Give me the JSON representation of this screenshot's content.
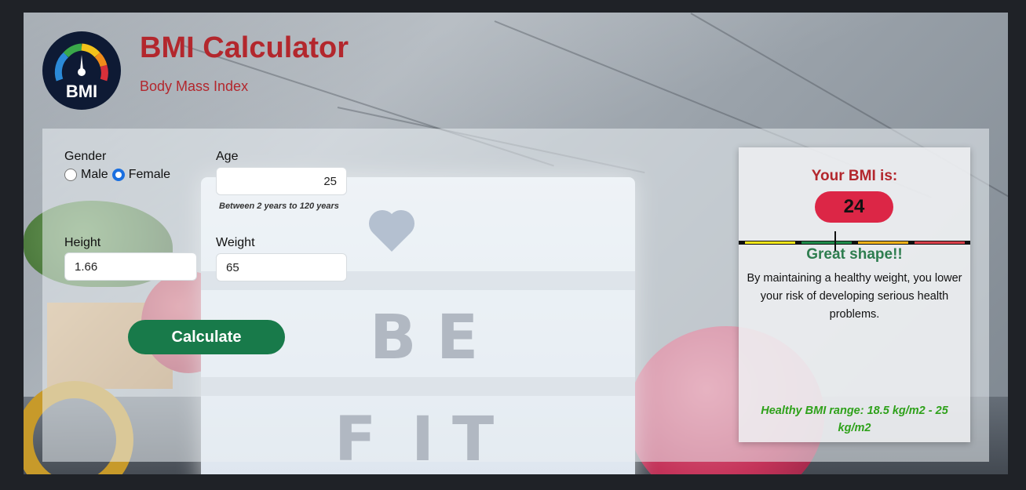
{
  "header": {
    "logo_text": "BMI",
    "title": "BMI Calculator",
    "subtitle": "Body Mass Index"
  },
  "background": {
    "lightbox_letters": [
      "B",
      "E",
      "F",
      "I",
      "T"
    ]
  },
  "form": {
    "gender_label": "Gender",
    "gender_options": [
      {
        "label": "Male",
        "checked": false
      },
      {
        "label": "Female",
        "checked": true
      }
    ],
    "age_label": "Age",
    "age_value": "25",
    "age_hint": "Between 2 years to 120 years",
    "height_label": "Height",
    "height_value": "1.66",
    "weight_label": "Weight",
    "weight_value": "65",
    "calculate_label": "Calculate"
  },
  "result": {
    "title": "Your BMI is:",
    "bmi_value": "24",
    "status": "Great shape!!",
    "description": "By maintaining a healthy weight, you lower your risk of developing serious health problems.",
    "healthy_range": "Healthy BMI range: 18.5 kg/m2 - 25 kg/m2",
    "scale_colors": [
      "#f5e61a",
      "#1e8a4a",
      "#f2b21a",
      "#d8404a"
    ],
    "badge_color": "#dc2646",
    "status_color": "#2e7d4f"
  }
}
